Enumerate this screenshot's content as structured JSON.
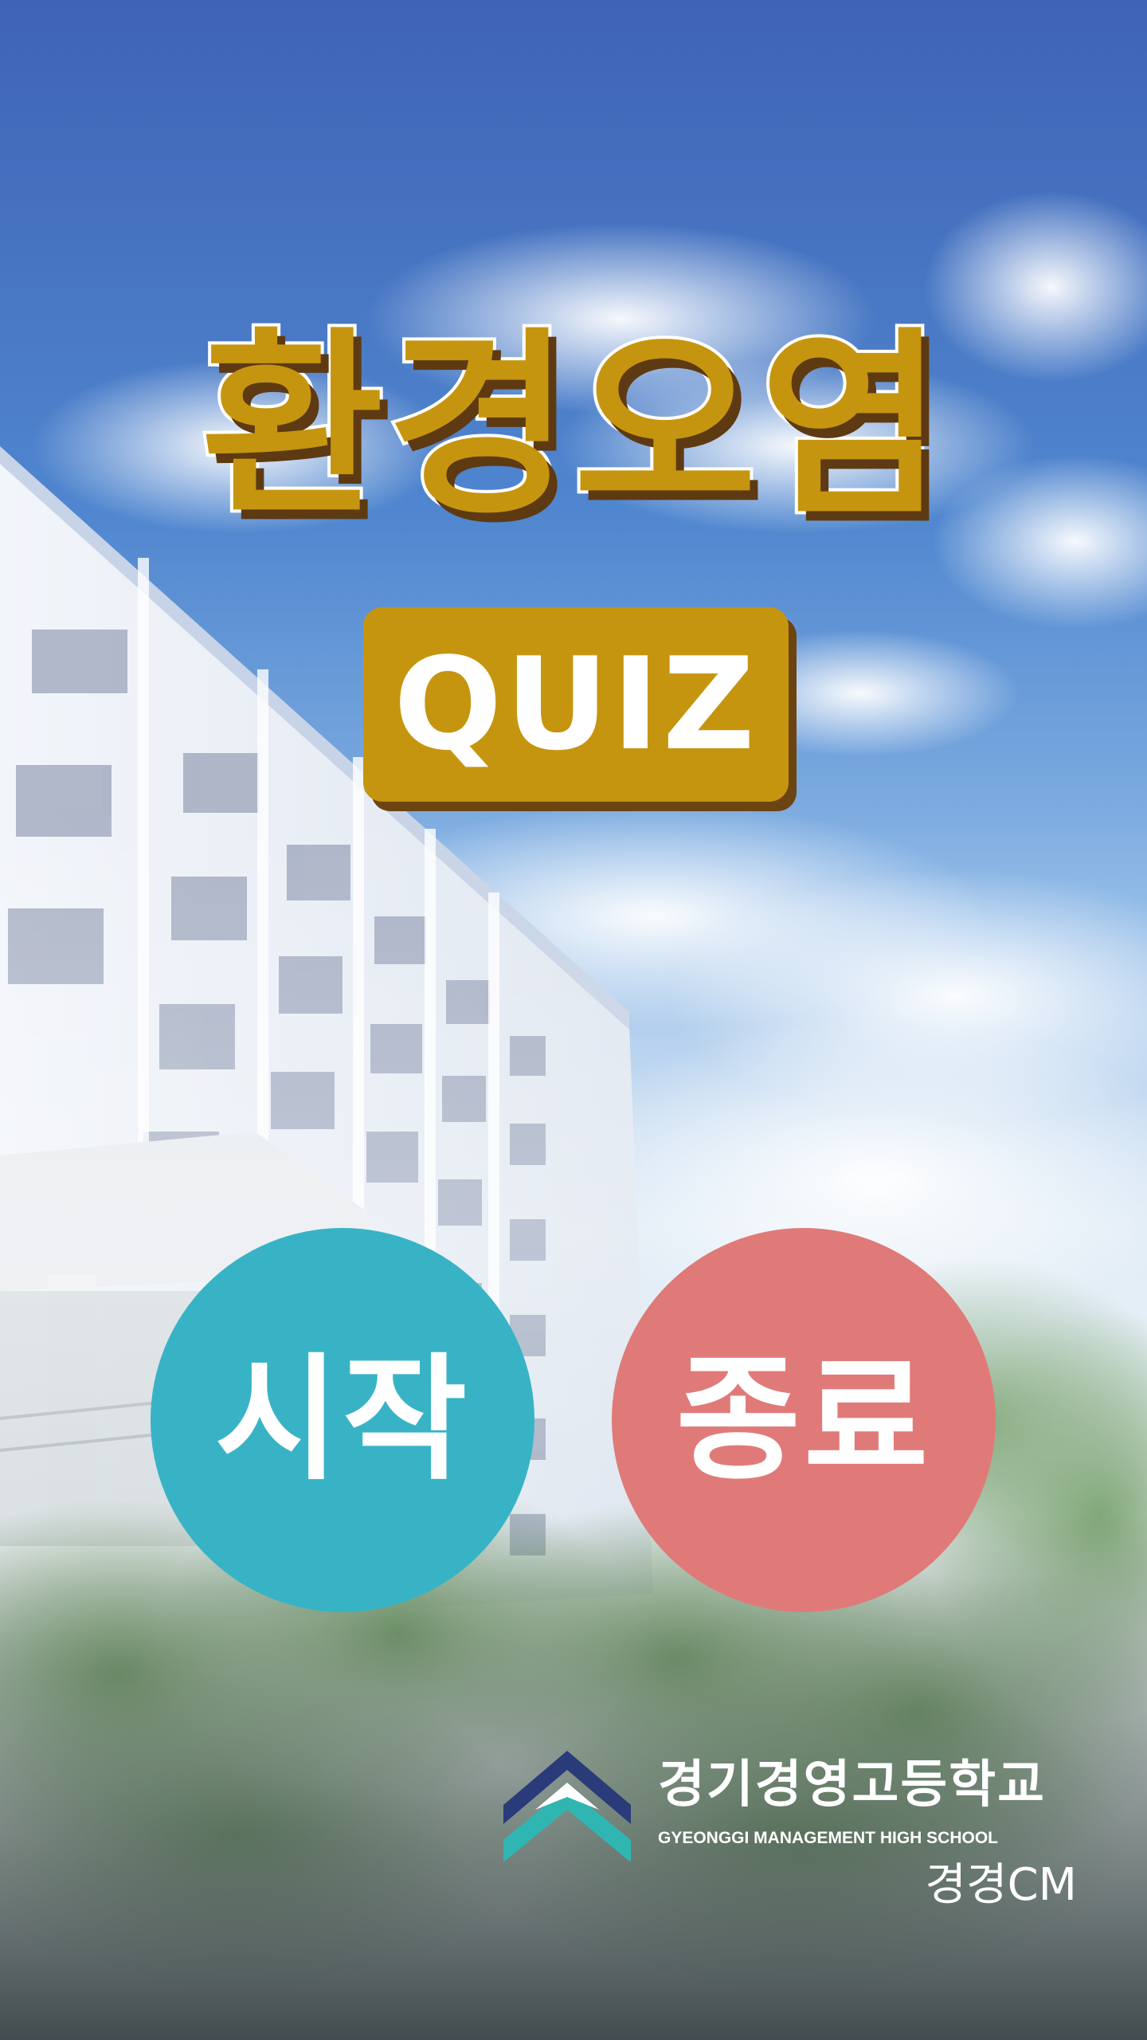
{
  "title": "환경오염",
  "subtitle_badge": "QUIZ",
  "buttons": {
    "start_label": "시작",
    "exit_label": "종료"
  },
  "school": {
    "name_ko": "경기경영고등학교",
    "name_en": "GYEONGGI MANAGEMENT HIGH SCHOOL",
    "brand": "경경CM"
  },
  "colors": {
    "title_gold": "#c6950f",
    "start_teal": "#38b3c6",
    "exit_coral": "#e07a79",
    "logo_navy": "#2a3b7a",
    "logo_teal": "#2fb6b2"
  },
  "icons": {
    "logo": "school-chevron-logo"
  }
}
